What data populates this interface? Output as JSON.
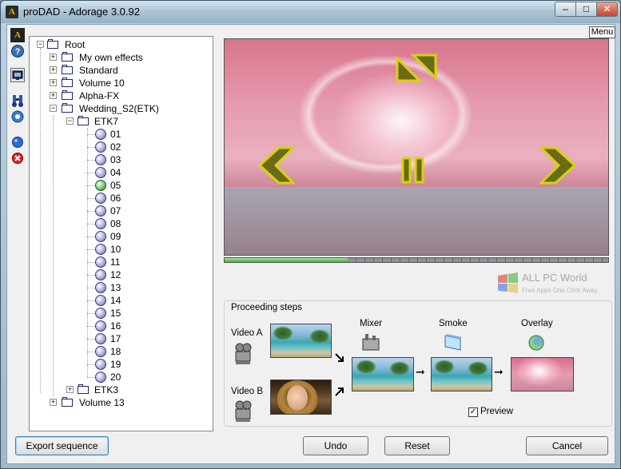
{
  "window": {
    "title": "proDAD - Adorage 3.0.92",
    "app_icon": "adorage-logo-icon",
    "controls": {
      "minimize": "–",
      "maximize": "□",
      "close": "✕"
    }
  },
  "toolbar": {
    "menu_label": "Menu",
    "tools": [
      "adorage-logo-icon",
      "help-icon",
      "monitor-icon",
      "binoculars-icon",
      "settings-icon",
      "blue-ball-icon",
      "delete-icon"
    ]
  },
  "tree": {
    "root": "Root",
    "folders": [
      "My own effects",
      "Standard",
      "Volume 10",
      "Alpha-FX",
      "Wedding_S2(ETK)"
    ],
    "subfolder": "ETK7",
    "items": [
      "01",
      "02",
      "03",
      "04",
      "05",
      "06",
      "07",
      "08",
      "09",
      "10",
      "11",
      "12",
      "13",
      "14",
      "15",
      "16",
      "17",
      "18",
      "19",
      "20"
    ],
    "selected_item": "05",
    "after": [
      "ETK3",
      "Volume 13"
    ]
  },
  "preview": {
    "progress_fraction": 0.32
  },
  "watermark": {
    "title": "ALL PC World",
    "subtitle": "Free Apps One Click Away"
  },
  "steps": {
    "legend": "Proceeding steps",
    "video_a": "Video A",
    "video_b": "Video B",
    "mixer": "Mixer",
    "smoke": "Smoke",
    "overlay": "Overlay",
    "preview_label": "Preview",
    "preview_checked": "✓"
  },
  "buttons": {
    "export": "Export sequence",
    "undo": "Undo",
    "reset": "Reset",
    "cancel": "Cancel"
  },
  "colors": {
    "accent_arrow": "#d7d20c",
    "arrow_fill": "#6b6a16",
    "progress_green": "#3faf3f"
  }
}
